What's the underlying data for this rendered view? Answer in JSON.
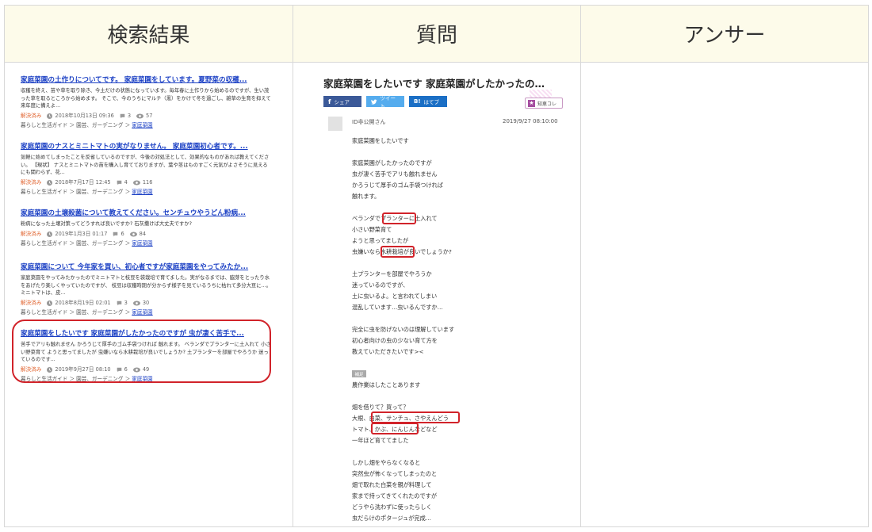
{
  "headers": {
    "search": "検索結果",
    "question": "質問",
    "answer": "アンサー"
  },
  "results": [
    {
      "title": "家庭菜園の土作りについてです。 家庭菜園をしています。夏野菜の収穫...",
      "snippet": "収穫を終え、苗や草を取り除き、今土だけの状態になっています。毎年春に土作りから始めるのですが、生い茂った草を取るところから始めます。 そこで、今のうちにマルチ（黒）をかけて冬を過ごし、雑草の生育を抑えて来年度に備えよ...",
      "status": "解決済み",
      "date": "2018年10月13日 09:36",
      "answers": "3",
      "views": "57",
      "breadcrumb": "暮らしと生活ガイド ＞ 園芸、ガーデニング ＞",
      "category": "家庭菜園"
    },
    {
      "title": "家庭菜園のナスとミニトマトの実がなりません。 家庭菜園初心者です。...",
      "snippet": "気軽に始めてしまったことを反省しているのですが、今後の対処法として、効果的なものがあれば教えてください。 【現状】 ナスとミニトマトの苗を購入し育てておりますが、葉や茎はものすごく元気がよさそうに見えるにも関わらず、花...",
      "status": "解決済み",
      "date": "2018年7月17日 12:45",
      "answers": "4",
      "views": "116",
      "breadcrumb": "暮らしと生活ガイド ＞ 園芸、ガーデニング ＞",
      "category": "家庭菜園"
    },
    {
      "title": "家庭菜園の土壌殺菌について教えてください。センチュウやうどん粉病...",
      "snippet": "粉病になった土壌対策ってどうすれば良いですか? 石灰撒けば大丈夫ですか?",
      "status": "解決済み",
      "date": "2019年1月3日 01:17",
      "answers": "6",
      "views": "84",
      "breadcrumb": "暮らしと生活ガイド ＞ 園芸、ガーデニング ＞",
      "category": "家庭菜園"
    },
    {
      "title": "家庭菜園について 今年家を買い、初心者ですが家庭菜園をやってみたか...",
      "snippet": "家庭菜園をやってみたかったのでミニトマトと枝豆を袋栽培で育てました。実がなるまでは、脇芽をとったり水をあげたり楽しくやっていたのですが、 枝豆は収穫時期が分からず様子を見ているうちに枯れて多分大豆に…。ミニトマトは、皮...",
      "status": "解決済み",
      "date": "2018年8月19日 02:01",
      "answers": "3",
      "views": "30",
      "breadcrumb": "暮らしと生活ガイド ＞ 園芸、ガーデニング ＞",
      "category": "家庭菜園"
    },
    {
      "title": "家庭菜園をしたいです 家庭菜園がしたかったのですが 虫が凄く苦手で...",
      "snippet": "苦手でアリも触れません かろうじて厚手のゴム手袋つければ 触れます。 ベランダでプランターに土入れて 小さい野菜育て ようと思ってましたが 虫嫌いなら水耕栽培が良いでしょうか? 土プランターを部屋でやろうか 迷っているのです...",
      "status": "解決済み",
      "date": "2019年9月27日 08:10",
      "answers": "6",
      "views": "49",
      "breadcrumb": "暮らしと生活ガイド ＞ 園芸、ガーデニング ＞",
      "category": "家庭菜園"
    }
  ],
  "question": {
    "title": "家庭菜園をしたいです 家庭菜園がしたかったの…",
    "share": [
      "シェア",
      "ツイート",
      "はてブ"
    ],
    "chie": "知恵コレ",
    "asker": "ID非公開さん",
    "date": "2019/9/27 08:10:00",
    "body1": "家庭菜園をしたいです\n\n家庭菜園がしたかったのですが\n虫が凄く苦手でアリも触れません\nかろうじて厚手のゴム手袋つければ\n触れます。\n\nベランダでプランターに土入れて\n小さい野菜育て\nようと思ってましたが\n虫嫌いなら水耕栽培が良いでしょうか?\n\n土プランターを部屋でやろうか\n迷っているのですが、\n土に虫いるよ。と言われてしまい\n混乱しています…虫いるんですか…\n\n完全に虫を防げないのは理解しています\n初心者向けの虫の少ない育て方を\n教えていただきたいです><",
    "hosoku": "補足",
    "body2": "農作業はしたことあります\n\n畑を借りて？買って？\n大根、白菜、サンチュ、さやえんどう\nトマト、かぶ、にんじんなどなど\n一年ほど育ててました\n\nしかし畑をやらなくなると\n突然虫が怖くなってしまったのと\n畑で取れた白菜を親が料理して\n家まで持ってきてくれたのですが\nどうやら洗わずに使ったらしく\n虫だらけのポタージュが完成…"
  },
  "colors": {
    "link": "#1a3fc4",
    "solved": "#e0622d",
    "highlight": "#d1232a",
    "header_bg": "#fdfbea"
  }
}
